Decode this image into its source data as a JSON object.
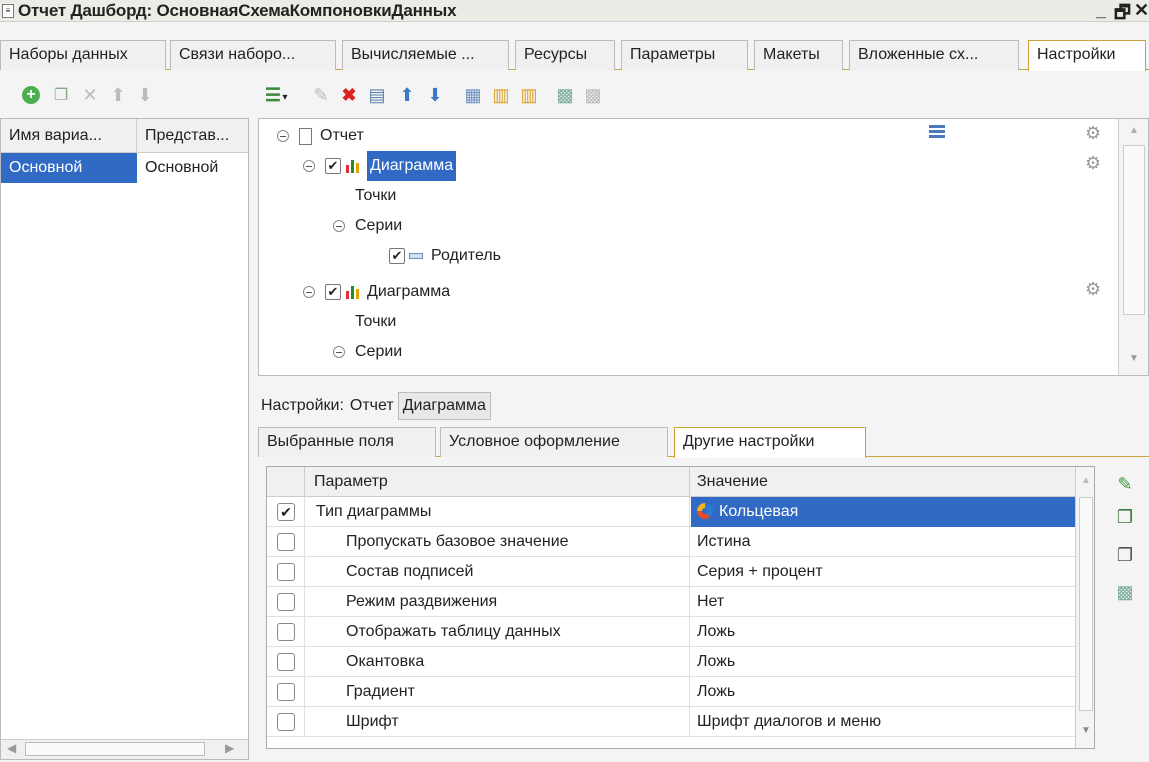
{
  "window": {
    "title": "Отчет Дашборд: ОсновнаяСхемаКомпоновкиДанных",
    "controls": [
      "_",
      "🗗",
      "✕"
    ]
  },
  "main_tabs": [
    {
      "label": "Наборы данных"
    },
    {
      "label": "Связи наборо..."
    },
    {
      "label": "Вычисляемые ..."
    },
    {
      "label": "Ресурсы"
    },
    {
      "label": "Параметры"
    },
    {
      "label": "Макеты"
    },
    {
      "label": "Вложенные сх..."
    },
    {
      "label": "Настройки"
    }
  ],
  "variants": {
    "columns": [
      "Имя вариа...",
      "Представ..."
    ],
    "rows": [
      {
        "name": "Основной",
        "presentation": "Основной"
      }
    ]
  },
  "tree": {
    "root": "Отчет",
    "chart1": "Диаграмма",
    "points1": "Точки",
    "series1": "Серии",
    "parent": "Родитель",
    "chart2": "Диаграмма",
    "points2": "Точки",
    "series2": "Серии"
  },
  "settings_bar": {
    "label": "Настройки:",
    "report": "Отчет",
    "chart": "Диаграмма"
  },
  "sub_tabs": [
    {
      "label": "Выбранные поля"
    },
    {
      "label": "Условное оформление"
    },
    {
      "label": "Другие настройки"
    }
  ],
  "grid": {
    "columns": {
      "param": "Параметр",
      "value": "Значение"
    },
    "rows": [
      {
        "param": "Тип диаграммы",
        "value": "Кольцевая",
        "checked": true
      },
      {
        "param": "Пропускать базовое значение",
        "value": "Истина",
        "checked": false
      },
      {
        "param": "Состав подписей",
        "value": "Серия + процент",
        "checked": false
      },
      {
        "param": "Режим раздвижения",
        "value": "Нет",
        "checked": false
      },
      {
        "param": "Отображать таблицу данных",
        "value": "Ложь",
        "checked": false
      },
      {
        "param": "Окантовка",
        "value": "Ложь",
        "checked": false
      },
      {
        "param": "Градиент",
        "value": "Ложь",
        "checked": false
      },
      {
        "param": "Шрифт",
        "value": "Шрифт диалогов и меню",
        "checked": false
      }
    ]
  },
  "colors": {
    "selection": "#316ac5",
    "tab_accent": "#c9a33a"
  }
}
